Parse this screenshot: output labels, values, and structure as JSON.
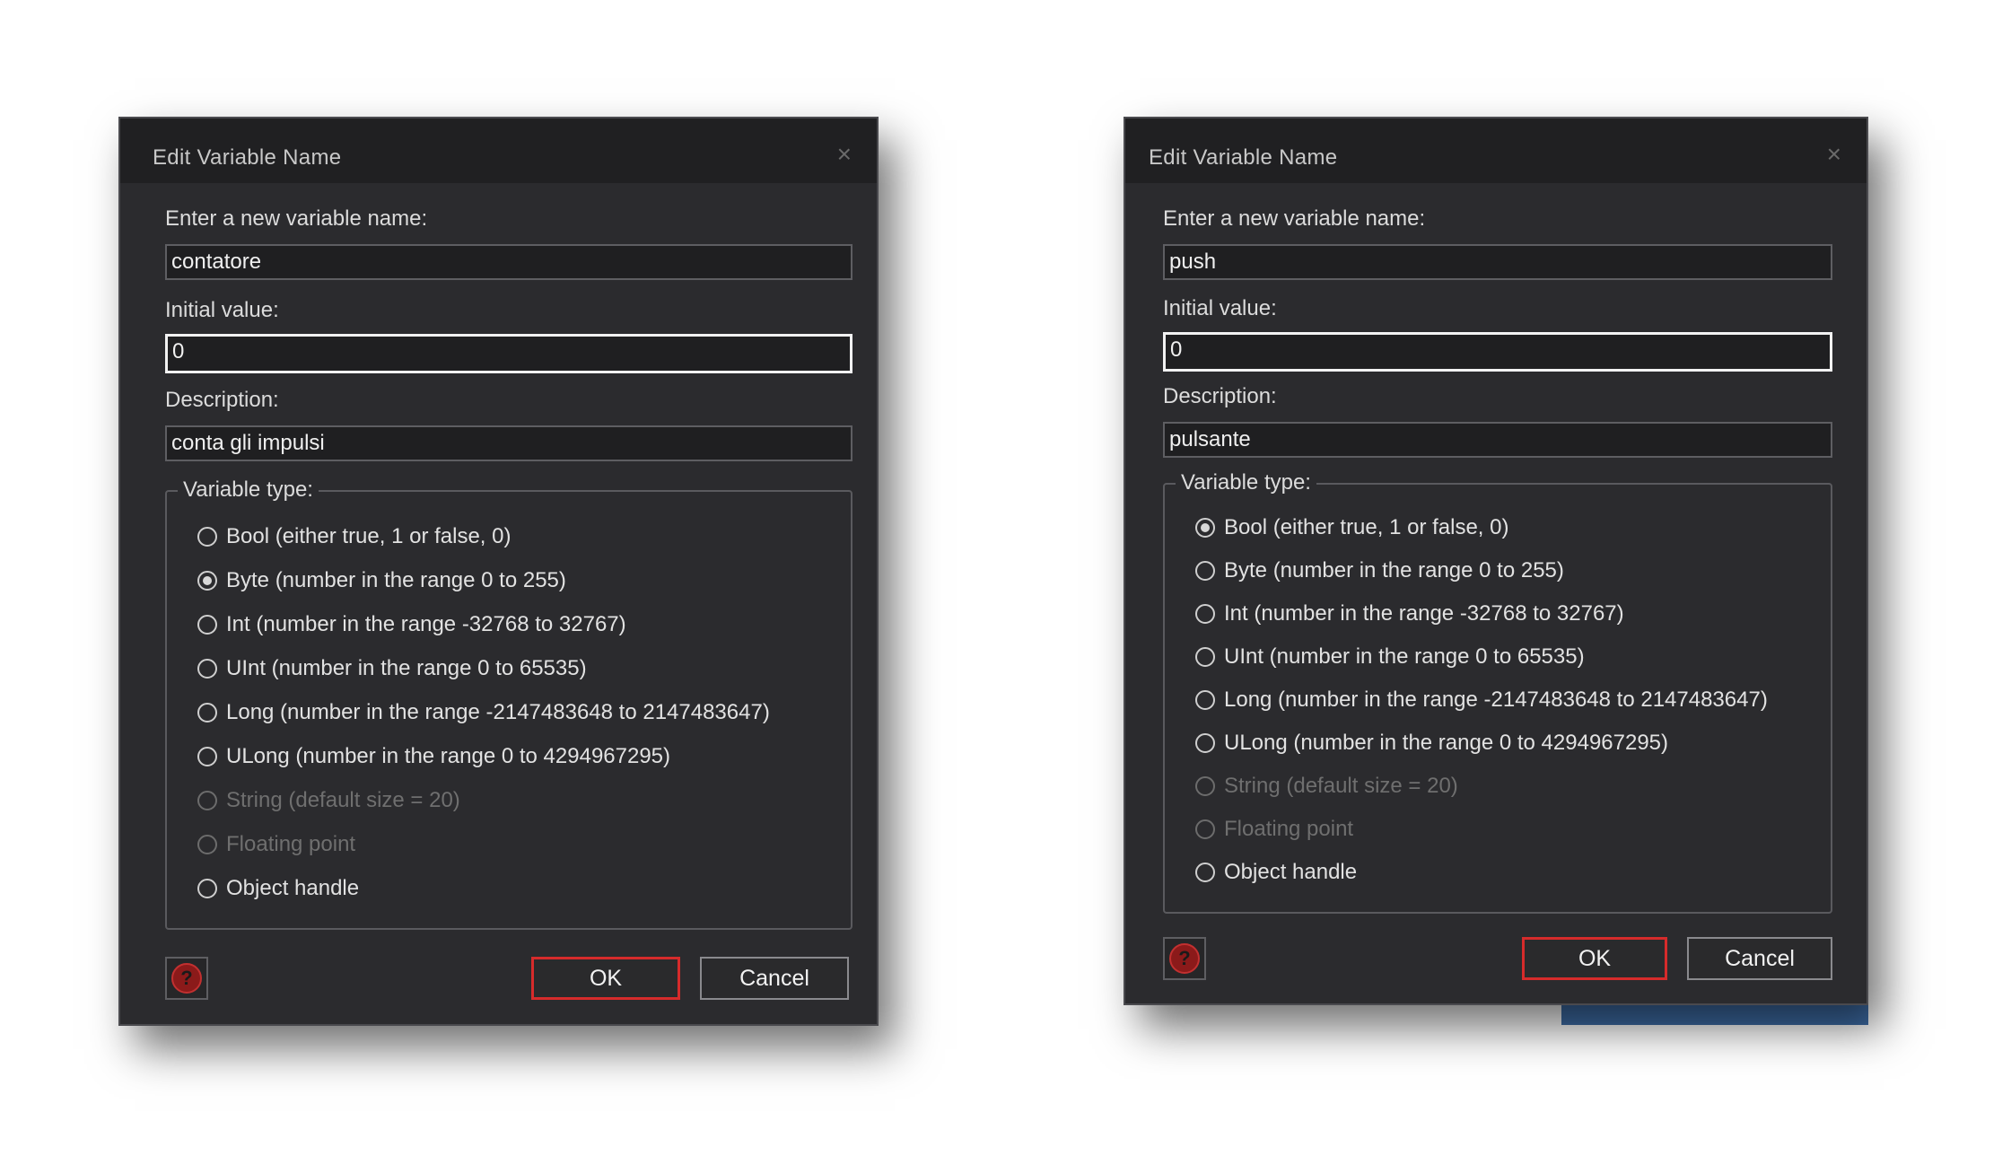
{
  "dialogs": [
    {
      "title": "Edit Variable Name",
      "close_glyph": "×",
      "name_label": "Enter a new variable name:",
      "name_value": "contatore",
      "initial_label": "Initial value:",
      "initial_value": "0",
      "description_label": "Description:",
      "description_value": "conta gli impulsi",
      "type_legend": "Variable type:",
      "types": [
        {
          "label": "Bool (either true, 1 or false, 0)",
          "checked": false,
          "enabled": true
        },
        {
          "label": "Byte (number in the range 0 to 255)",
          "checked": true,
          "enabled": true
        },
        {
          "label": "Int (number in the range -32768 to 32767)",
          "checked": false,
          "enabled": true
        },
        {
          "label": "UInt (number in the range 0 to 65535)",
          "checked": false,
          "enabled": true
        },
        {
          "label": "Long (number in the range -2147483648 to 2147483647)",
          "checked": false,
          "enabled": true
        },
        {
          "label": "ULong (number in the range 0 to 4294967295)",
          "checked": false,
          "enabled": true
        },
        {
          "label": "String (default size = 20)",
          "checked": false,
          "enabled": false
        },
        {
          "label": "Floating point",
          "checked": false,
          "enabled": false
        },
        {
          "label": "Object handle",
          "checked": false,
          "enabled": true
        }
      ],
      "help_glyph": "?",
      "ok_label": "OK",
      "cancel_label": "Cancel"
    },
    {
      "title": "Edit Variable Name",
      "close_glyph": "×",
      "name_label": "Enter a new variable name:",
      "name_value": "push",
      "initial_label": "Initial value:",
      "initial_value": "0",
      "description_label": "Description:",
      "description_value": "pulsante",
      "type_legend": "Variable type:",
      "types": [
        {
          "label": "Bool (either true, 1 or false, 0)",
          "checked": true,
          "enabled": true
        },
        {
          "label": "Byte (number in the range 0 to 255)",
          "checked": false,
          "enabled": true
        },
        {
          "label": "Int (number in the range -32768 to 32767)",
          "checked": false,
          "enabled": true
        },
        {
          "label": "UInt (number in the range 0 to 65535)",
          "checked": false,
          "enabled": true
        },
        {
          "label": "Long (number in the range -2147483648 to 2147483647)",
          "checked": false,
          "enabled": true
        },
        {
          "label": "ULong (number in the range 0 to 4294967295)",
          "checked": false,
          "enabled": true
        },
        {
          "label": "String (default size = 20)",
          "checked": false,
          "enabled": false
        },
        {
          "label": "Floating point",
          "checked": false,
          "enabled": false
        },
        {
          "label": "Object handle",
          "checked": false,
          "enabled": true
        }
      ],
      "help_glyph": "?",
      "ok_label": "OK",
      "cancel_label": "Cancel"
    }
  ],
  "colors": {
    "dialog_bg": "#2b2b2e",
    "titlebar_bg": "#202022",
    "default_button_border": "#d62b2b",
    "help_icon": "#8b1a1a"
  }
}
